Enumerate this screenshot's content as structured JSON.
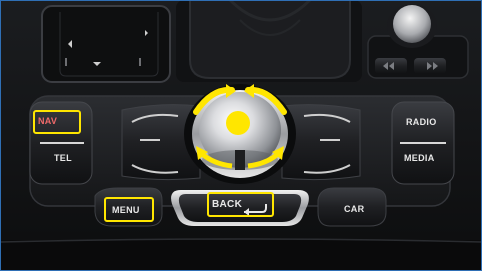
{
  "buttons": {
    "nav": "NAV",
    "tel": "TEL",
    "menu": "MENU",
    "back": "BACK",
    "car": "CAR",
    "radio": "RADIO",
    "media": "MEDIA"
  },
  "colors": {
    "highlight": "#ffe600",
    "nav_label": "#f06a6a",
    "label": "#e8e8e8",
    "frame": "#2f6fb5"
  },
  "icons": [
    "knob-rotation-arrows-icon",
    "return-arrow-icon",
    "skip-previous-icon",
    "skip-next-icon",
    "touchpad-arrows-icon"
  ]
}
